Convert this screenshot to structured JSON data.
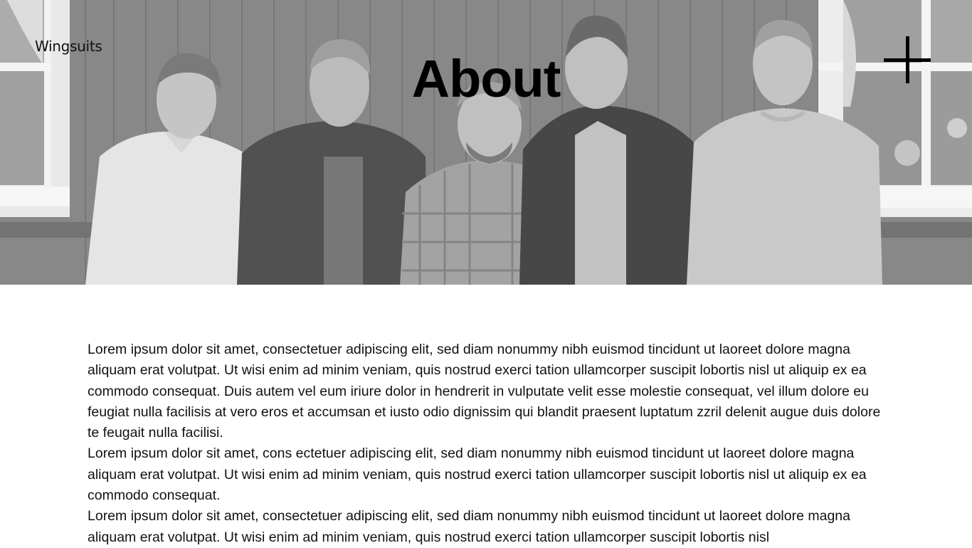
{
  "header": {
    "brand": "Wingsuits",
    "title": "About",
    "menu_icon": "plus-icon"
  },
  "hero": {
    "image_alt": "Black and white photo of five band members standing in front of a wooden wall with windows"
  },
  "content": {
    "paragraphs": [
      "Lorem ipsum dolor sit amet, consectetuer adipiscing elit, sed diam nonummy nibh euismod tincidunt ut laoreet dolore magna aliquam erat volutpat. Ut wisi enim ad minim veniam, quis nostrud exerci tation ullamcorper suscipit lobortis nisl ut aliquip ex ea commodo consequat. Duis autem vel eum iriure dolor in hendrerit in vulputate velit esse molestie conse­quat, vel illum dolore eu feugiat nulla facilisis at vero eros et accumsan et iusto odio dignissim qui blandit praesent lup­tatum zzril delenit augue duis dolore te feugait nulla facilisi.",
      "Lorem ipsum dolor sit amet, cons ectetuer adipiscing elit, sed diam nonummy nibh euismod tincidunt ut laoreet dolore magna aliquam erat volutpat. Ut wisi enim ad minim veniam, quis nostrud exerci tation ullamcorper suscipit lobortis nisl ut aliquip ex ea commodo consequat.",
      "Lorem ipsum dolor sit amet, consectetuer adipiscing elit, sed diam nonummy nibh euismod tincidunt ut laoreet dolore magna aliquam erat volutpat. Ut wisi enim ad minim veniam, quis nostrud exerci tation ullamcorper suscipit lobortis nisl"
    ]
  },
  "colors": {
    "text": "#111111",
    "background": "#ffffff",
    "hero_gray": "#6b6b6b"
  }
}
